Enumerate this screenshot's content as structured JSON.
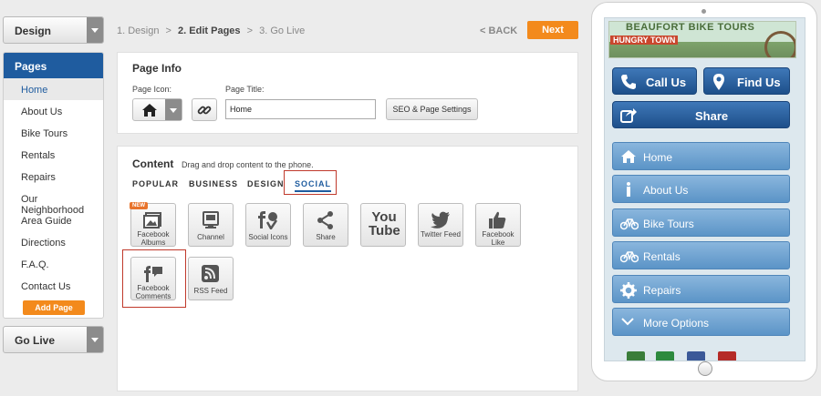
{
  "left": {
    "design_dropdown": "Design",
    "pages_header": "Pages",
    "pages": [
      "Home",
      "About Us",
      "Bike Tours",
      "Rentals",
      "Repairs",
      "Our Neighborhood",
      "Area Guide",
      "Directions",
      "F.A.Q.",
      "Contact Us"
    ],
    "active_page_index": 0,
    "add_page": "Add Page",
    "go_live_dropdown": "Go Live"
  },
  "steps": {
    "step1": "1. Design",
    "sep1": ">",
    "step2": "2. Edit Pages",
    "sep2": ">",
    "step3": "3. Go Live"
  },
  "nav": {
    "back": "< BACK",
    "next": "Next"
  },
  "page_info": {
    "title": "Page Info",
    "icon_label": "Page Icon:",
    "title_label": "Page Title:",
    "title_value": "Home",
    "seo_button": "SEO & Page Settings"
  },
  "content": {
    "title": "Content",
    "hint": "Drag and drop content to the phone.",
    "tabs": [
      "POPULAR",
      "BUSINESS",
      "DESIGN",
      "SOCIAL"
    ],
    "selected_tab": "SOCIAL",
    "tiles": [
      {
        "label": "Facebook Albums",
        "icon": "photo-album-icon",
        "badge": "NEW"
      },
      {
        "label": "Channel",
        "icon": "youtube-channel-icon"
      },
      {
        "label": "Social Icons",
        "icon": "social-icons-icon"
      },
      {
        "label": "Share",
        "icon": "share-icon"
      },
      {
        "label": "YouTube",
        "icon": "youtube-icon",
        "glyph": "You Tube"
      },
      {
        "label": "Twitter Feed",
        "icon": "twitter-icon"
      },
      {
        "label": "Facebook Like",
        "icon": "thumbs-up-icon"
      },
      {
        "label": "Facebook Comments",
        "icon": "facebook-comments-icon"
      },
      {
        "label": "RSS Feed",
        "icon": "rss-icon"
      }
    ]
  },
  "phone": {
    "banner_title": "BEAUFORT BIKE TOURS",
    "banner_sub": "HUNGRY TOWN",
    "call_us": "Call Us",
    "find_us": "Find Us",
    "share": "Share",
    "menu": [
      {
        "label": "Home",
        "icon": "home-icon"
      },
      {
        "label": "About Us",
        "icon": "info-icon"
      },
      {
        "label": "Bike Tours",
        "icon": "bicycle-icon"
      },
      {
        "label": "Rentals",
        "icon": "bicycle-icon"
      },
      {
        "label": "Repairs",
        "icon": "gear-icon"
      },
      {
        "label": "More Options",
        "icon": "chevron-down-icon"
      }
    ],
    "social_colors": [
      "#3a7d3a",
      "#2d8a3e",
      "#3b5998",
      "#b52b27"
    ]
  },
  "colors": {
    "accent": "#f38a1c",
    "primary": "#1f5c9f",
    "highlight": "#c0392b"
  }
}
